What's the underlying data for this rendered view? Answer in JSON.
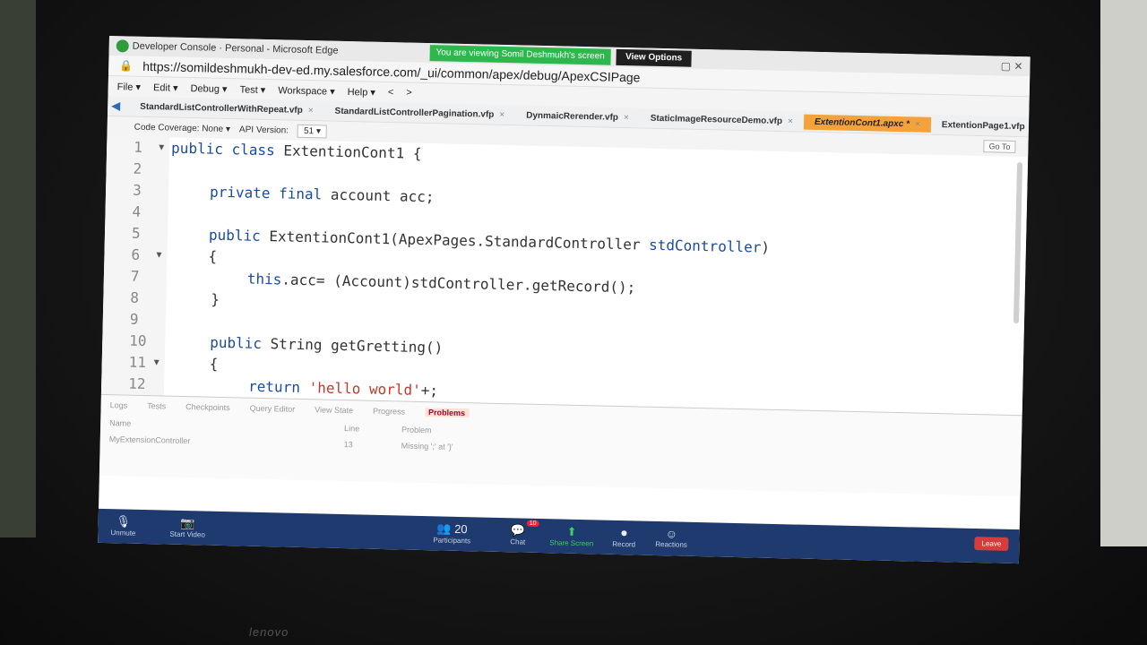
{
  "window": {
    "title": "Developer Console · Personal - Microsoft Edge"
  },
  "share_banner": "You are viewing Somil Deshmukh's screen",
  "view_options": "View Options",
  "url": "https://somildeshmukh-dev-ed.my.salesforce.com/_ui/common/apex/debug/ApexCSIPage",
  "menu": [
    "File ▾",
    "Edit ▾",
    "Debug ▾",
    "Test ▾",
    "Workspace ▾",
    "Help ▾",
    "<",
    ">"
  ],
  "tabs": [
    {
      "label": "StandardListControllerWithRepeat.vfp"
    },
    {
      "label": "StandardListControllerPagination.vfp"
    },
    {
      "label": "DynmaicRerender.vfp"
    },
    {
      "label": "StaticImageResourceDemo.vfp"
    },
    {
      "label": "ExtentionCont1.apxc *"
    },
    {
      "label": "ExtentionPage1.vfp"
    }
  ],
  "toolbar": {
    "coverage_label": "Code Coverage: None",
    "api_label": "API Version:",
    "api_value": "51",
    "goto": "Go To"
  },
  "code": {
    "lines": [
      {
        "n": "1",
        "fold": "▼"
      },
      {
        "n": "2",
        "fold": ""
      },
      {
        "n": "3",
        "fold": ""
      },
      {
        "n": "4",
        "fold": ""
      },
      {
        "n": "5",
        "fold": ""
      },
      {
        "n": "6",
        "fold": "▼"
      },
      {
        "n": "7",
        "fold": ""
      },
      {
        "n": "8",
        "fold": ""
      },
      {
        "n": "9",
        "fold": ""
      },
      {
        "n": "10",
        "fold": ""
      },
      {
        "n": "11",
        "fold": "▼"
      },
      {
        "n": "12",
        "fold": ""
      }
    ],
    "l1": {
      "kw": "public class",
      "rest": " ExtentionCont1 {"
    },
    "l3": {
      "kw": "private final",
      "rest": " account acc;"
    },
    "l5": {
      "kw": "public",
      "rest": " ExtentionCont1(ApexPages.StandardController ",
      "kw2": "stdController",
      "end": ")"
    },
    "l6": "{",
    "l7": {
      "kw": "this",
      "rest": ".acc= (Account)stdController.getRecord();"
    },
    "l8": "}",
    "l10": {
      "kw": "public",
      "rest": " String getGretting()"
    },
    "l11": "{",
    "l12": {
      "kw": "return",
      "str": "'hello world'",
      "end": "+;"
    }
  },
  "panel": {
    "tabs": [
      "Logs",
      "Tests",
      "Checkpoints",
      "Query Editor",
      "View State",
      "Progress",
      "Problems"
    ],
    "headers": {
      "name": "Name",
      "line": "Line",
      "problem": "Problem"
    },
    "row": {
      "name": "MyExtensionController",
      "line": "13",
      "problem": "Missing ';' at ')'"
    }
  },
  "zoom": {
    "unmute": "Unmute",
    "video": "Start Video",
    "participants_count": "20",
    "participants": "Participants",
    "chat": "Chat",
    "chat_badge": "10",
    "share": "Share Screen",
    "record": "Record",
    "reactions": "Reactions",
    "leave": "Leave"
  },
  "brand": "lenovo"
}
